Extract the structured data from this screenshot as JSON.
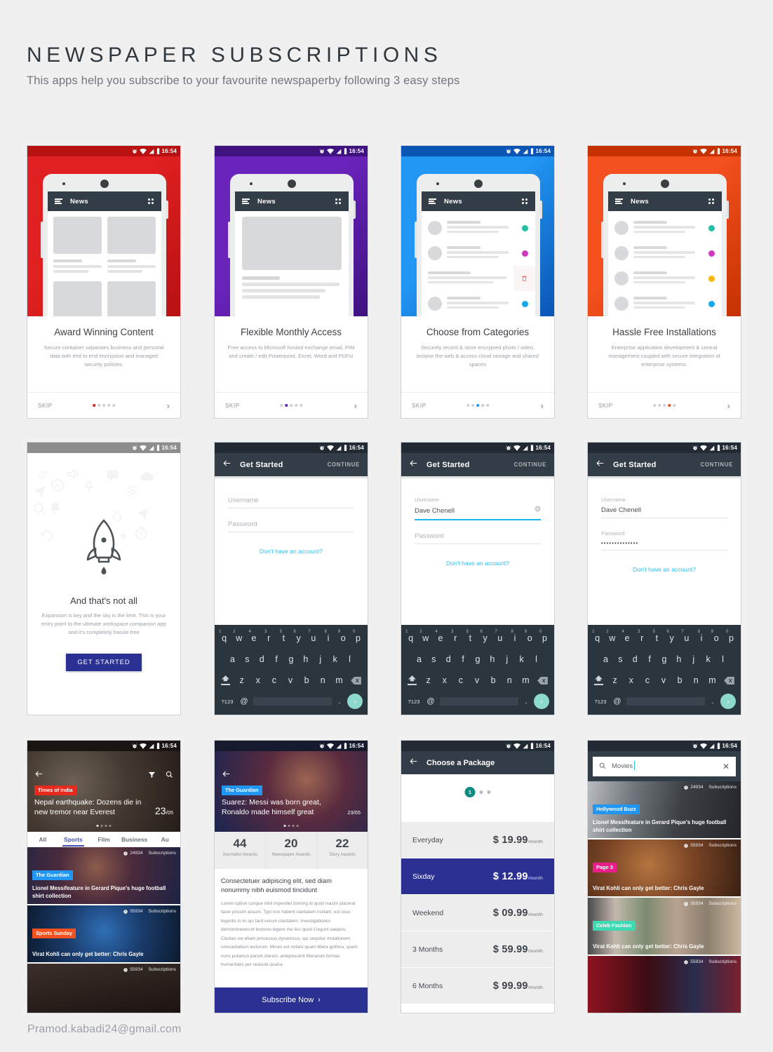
{
  "header": {
    "title": "NEWSPAPER SUBSCRIPTIONS",
    "subtitle": "This apps help you subscribe to your favourite newspaperby following 3 easy steps"
  },
  "footer": {
    "email": "Pramod.kabadi24@gmail.com"
  },
  "status_bar": {
    "time": "16:54"
  },
  "common": {
    "skip_label": "SKIP",
    "app_name": "News",
    "continue_label": "CONTINUE",
    "get_started_title": "Get Started",
    "username_label": "Username",
    "password_label": "Password",
    "no_account_link": "Don't have an account?",
    "subscriptions_suffix": "Subscriptions"
  },
  "onboarding": [
    {
      "accent": "#e02020",
      "accent2": "#b71111",
      "title": "Award Winning Content",
      "desc": "Secure container separates business and personal data with end to end encryption and managed security policies.",
      "layout": "tiles",
      "active_dot": 0
    },
    {
      "accent": "#6a23bb",
      "accent2": "#3f1280",
      "title": "Flexible Monthly Access",
      "desc": "Free access to Microsoft hosted exchange email, PIM and create / edit Powerpoint, Excel, Word and PDFs!",
      "layout": "article",
      "active_dot": 1
    },
    {
      "accent": "#2196f3",
      "accent2": "#0b55b5",
      "title": "Choose from Categories",
      "desc": "Securely record & store encrypted photo / video, browse the web & access cloud storage and shared spaces",
      "layout": "list-delete",
      "active_dot": 2
    },
    {
      "accent": "#f4511e",
      "accent2": "#c53200",
      "title": "Hassle Free Installations",
      "desc": "Enterprise application development & central management coupled with secure integration of enterprise systems.",
      "layout": "list",
      "active_dot": 3
    }
  ],
  "list_dot_colors": [
    "#26bfa5",
    "#cd3bbd",
    "#f8b70c",
    "#14a9e8"
  ],
  "rocket_screen": {
    "title": "And that's not all",
    "desc": "Expansion is key and the sky is the limit. This is your entry point to the ultimate workspace companion app and it's completely hassle free",
    "button_label": "GET STARTED",
    "active_dot": 4
  },
  "login_screens": [
    {
      "username_value": "",
      "username_placeholder": "Username",
      "password_value": "",
      "password_placeholder": "Password",
      "username_active": false,
      "show_clear": false
    },
    {
      "username_value": "Dave Chenell",
      "username_placeholder": "Username",
      "password_value": "",
      "password_placeholder": "Password",
      "username_active": true,
      "show_clear": true
    },
    {
      "username_value": "Dave Chenell",
      "username_placeholder": "Username",
      "password_value": "••••••••••••••",
      "password_placeholder": "Password",
      "username_active": false,
      "show_clear": false
    }
  ],
  "keyboard": {
    "row1": [
      {
        "l": "q",
        "n": "1"
      },
      {
        "l": "w",
        "n": "2"
      },
      {
        "l": "e",
        "n": "4"
      },
      {
        "l": "r",
        "n": "3"
      },
      {
        "l": "t",
        "n": "5"
      },
      {
        "l": "y",
        "n": "6"
      },
      {
        "l": "u",
        "n": "7"
      },
      {
        "l": "i",
        "n": "8"
      },
      {
        "l": "o",
        "n": "9"
      },
      {
        "l": "p",
        "n": "0"
      }
    ],
    "row2": [
      "a",
      "s",
      "d",
      "f",
      "g",
      "h",
      "j",
      "k",
      "l"
    ],
    "row3": [
      "z",
      "x",
      "c",
      "v",
      "b",
      "n",
      "m"
    ],
    "numeric_key": "?123",
    "at_key": "@",
    "period_key": "."
  },
  "news_feed": {
    "hero": {
      "tag": "Times of india",
      "tag_color": "#e8291e",
      "headline": "Nepal earthquake: Dozens die in new tremor near Everest",
      "date_day": "23",
      "date_month": "/05"
    },
    "tabs": [
      {
        "label": "All",
        "active": false
      },
      {
        "label": "Sports",
        "active": true
      },
      {
        "label": "Film",
        "active": false
      },
      {
        "label": "Business",
        "active": false
      },
      {
        "label": "Au",
        "active": false
      }
    ],
    "cards": [
      {
        "tag": "The Guardian",
        "tag_color": "#2196f3",
        "title": "Lionel Messifeature in Gerard Pique's huge football shirt collection",
        "subs": "24934"
      },
      {
        "tag": "Sports Sunday",
        "tag_color": "#f4511e",
        "title": "Virat Kohli can only get better: Chris Gayle",
        "subs": "55934"
      },
      {
        "tag": "",
        "tag_color": "",
        "title": "",
        "subs": "55934"
      }
    ]
  },
  "article": {
    "hero": {
      "tag": "The Guardian",
      "tag_color": "#2196f3",
      "headline": "Suarez: Messi was born great, Ronaldo made himself great",
      "date_day": "23",
      "date_month": "/05"
    },
    "stats": [
      {
        "num": "44",
        "label": "Journalist Awards"
      },
      {
        "num": "20",
        "label": "Newspaper Awards"
      },
      {
        "num": "22",
        "label": "Story Awards"
      }
    ],
    "heading": "Consectetuer adipiscing elit, sed diam nonummy nibh euismod tincidunt",
    "paragraph": "Lorem option congue nihil imperdiet doming id quod mazim placerat facer possim assum. Typi non habent claritatem insitam; est usus legentis in iis qui facit eorum claritatem. Investigationes demonstraverunt lectores legere me lius quod ii legunt saepius. Claritas est etiam processus dynamicus, qui sequitur mutationem consuetudium lectorum. Mirum est notare quam littera gothica, quam nunc putamus parum claram, anteposuerit litterarum formas humanitatis per seacula quarta.",
    "cta_label": "Subscribe Now"
  },
  "package_screen": {
    "title": "Choose a Package",
    "step_number": "1",
    "rows": [
      {
        "name": "Everyday",
        "price": "$ 19.99",
        "per": "/month",
        "selected": false
      },
      {
        "name": "Sixday",
        "price": "$ 12.99",
        "per": "/month",
        "selected": true
      },
      {
        "name": "Weekend",
        "price": "$ 09.99",
        "per": "/month",
        "selected": false
      },
      {
        "name": "3 Months",
        "price": "$ 59.99",
        "per": "/month",
        "selected": false
      },
      {
        "name": "6 Months",
        "price": "$ 99.99",
        "per": "/month",
        "selected": false
      }
    ]
  },
  "search_screen": {
    "query": "Movies",
    "placeholder": "Search",
    "cards": [
      {
        "tag": "Hollywood Buzz",
        "tag_color": "#2196f3",
        "title": "Lionel Messifeature in Gerard Pique's huge football shirt collection",
        "subs": "24934"
      },
      {
        "tag": "Page 3",
        "tag_color": "#e91e8c",
        "title": "Virat Kohli can only get better: Chris Gayle",
        "subs": "55934"
      },
      {
        "tag": "Celeb Fashion",
        "tag_color": "#3dd9b3",
        "title": "Virat Kohli can only get better: Chris Gayle",
        "subs": "35934"
      },
      {
        "tag": "",
        "tag_color": "",
        "title": "",
        "subs": "55934"
      }
    ]
  }
}
